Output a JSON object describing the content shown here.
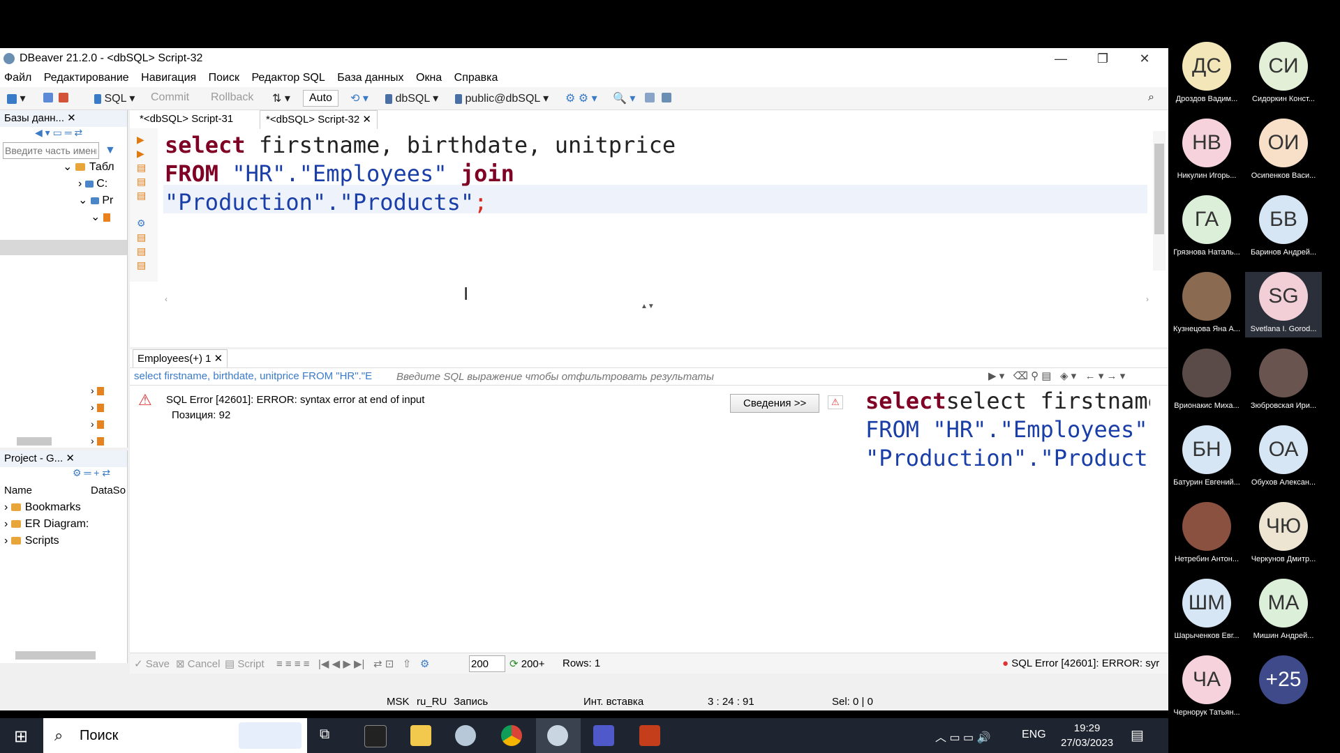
{
  "window": {
    "title": "DBeaver 21.2.0 - <dbSQL> Script-32",
    "menu": [
      "Файл",
      "Редактирование",
      "Навигация",
      "Поиск",
      "Редактор SQL",
      "База данных",
      "Окна",
      "Справка"
    ]
  },
  "toolbar": {
    "sql": "SQL",
    "commit": "Commit",
    "rollback": "Rollback",
    "auto": "Auto",
    "datasource": "dbSQL",
    "schema": "public@dbSQL"
  },
  "nav": {
    "tab": "Базы данн...",
    "filter_placeholder": "Введите часть имени",
    "tree": [
      "Табл",
      "C:",
      "Pr"
    ]
  },
  "project": {
    "tab": "Project - G...",
    "col_name": "Name",
    "col_ds": "DataSo",
    "items": [
      "Bookmarks",
      "ER Diagram:",
      "Scripts"
    ]
  },
  "editor": {
    "tabs": [
      "*<dbSQL> Script-31",
      "*<dbSQL> Script-32"
    ],
    "line1": {
      "kw": "select",
      "rest": " firstname, birthdate, unitprice"
    },
    "line2": {
      "kw1": "FROM",
      "str1": " \"HR\".\"Employees\" ",
      "kw2": "join"
    },
    "line3": {
      "str": "\"Production\".\"Products\"",
      "semi": ";"
    }
  },
  "results": {
    "tab": "Employees(+) 1",
    "query_text": "select firstname, birthdate, unitprice FROM \"HR\".\"E",
    "filter_placeholder": "Введите SQL выражение чтобы отфильтровать результаты",
    "error_title": "SQL Error [42601]: ERROR: syntax error at end of input",
    "error_position": "Позиция: 92",
    "details_button": "Сведения >>",
    "preview_line1": "select firstname, bir",
    "preview_line2": "FROM \"HR\".\"Employees\"",
    "preview_line3": "\"Production\".\"Products",
    "bottom": {
      "save": "Save",
      "cancel": "Cancel",
      "script": "Script",
      "fetch_size": "200",
      "fetch_more": "200+",
      "rows": "Rows: 1",
      "status_error": "SQL Error [42601]: ERROR: syr"
    }
  },
  "status": {
    "tz": "MSK",
    "locale": "ru_RU",
    "mode": "Запись",
    "insert": "Инт. вставка",
    "pos": "3 : 24 : 91",
    "sel": "Sel: 0 | 0"
  },
  "taskbar": {
    "search": "Поиск",
    "lang": "ENG",
    "time": "19:29",
    "date": "27/03/2023"
  },
  "participants": [
    {
      "initials": "ДС",
      "name": "Дроздов Вадим...",
      "color": "#f3e6b8"
    },
    {
      "initials": "СИ",
      "name": "Сидоркин Конст...",
      "color": "#e3efd6"
    },
    {
      "initials": "НВ",
      "name": "Никулин Игорь...",
      "color": "#f6d3dc"
    },
    {
      "initials": "ОИ",
      "name": "Осипенков Васи...",
      "color": "#f7dfc8"
    },
    {
      "initials": "ГА",
      "name": "Грязнова Наталь...",
      "color": "#dcefd8"
    },
    {
      "initials": "БВ",
      "name": "Баринов Андрей...",
      "color": "#d6e6f4"
    },
    {
      "initials": "",
      "name": "Кузнецова Яна А...",
      "color": "#8a6a50"
    },
    {
      "initials": "SG",
      "name": "Svetlana I. Gorod...",
      "color": "#f2cfd6"
    },
    {
      "initials": "",
      "name": "Врионакис Миха...",
      "color": "#5a4a48"
    },
    {
      "initials": "",
      "name": "Зюбровская Ири...",
      "color": "#6a5450"
    },
    {
      "initials": "БН",
      "name": "Батурин Евгений...",
      "color": "#d6e6f4"
    },
    {
      "initials": "ОА",
      "name": "Обухов Алексан...",
      "color": "#d6e6f4"
    },
    {
      "initials": "",
      "name": "Нетребин Антон...",
      "color": "#8a5040"
    },
    {
      "initials": "ЧЮ",
      "name": "Черкунов Дмитр...",
      "color": "#ede4d2"
    },
    {
      "initials": "ШМ",
      "name": "Шарыченков Евг...",
      "color": "#d6e6f4"
    },
    {
      "initials": "МА",
      "name": "Мишин Андрей...",
      "color": "#dcefd8"
    },
    {
      "initials": "ЧА",
      "name": "Чернорук Татьян...",
      "color": "#f6d3dc"
    },
    {
      "initials": "+25",
      "name": "",
      "color": "#3e4a8a"
    }
  ]
}
